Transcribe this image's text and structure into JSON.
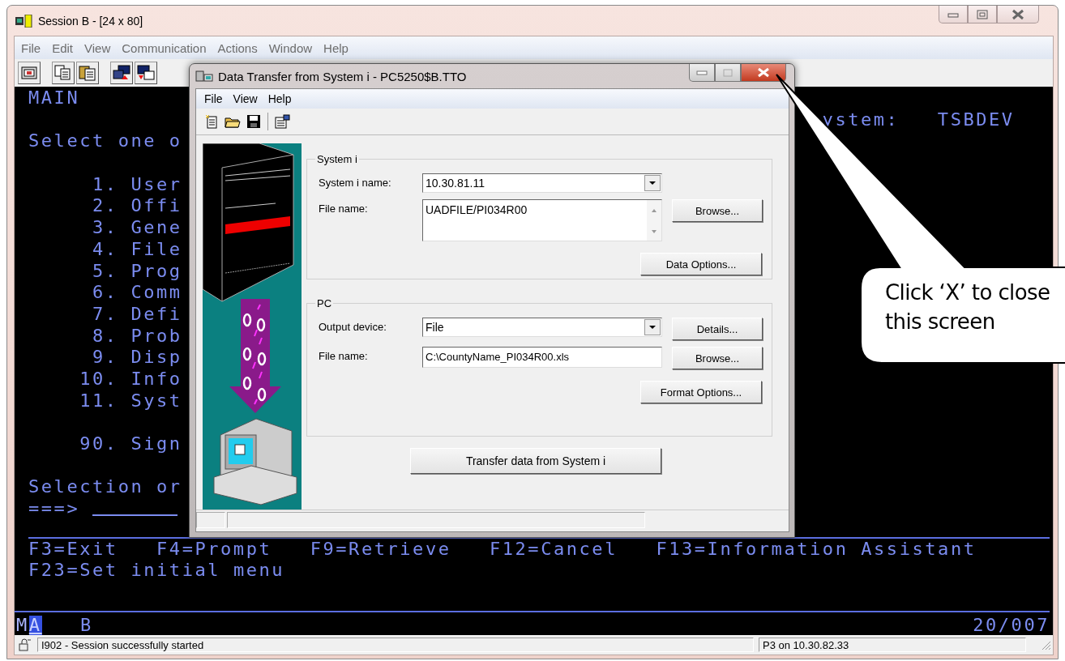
{
  "window": {
    "title": "Session B - [24 x 80]",
    "active": false
  },
  "menu": [
    "File",
    "Edit",
    "View",
    "Communication",
    "Actions",
    "Window",
    "Help"
  ],
  "terminal": {
    "menu_name": "MAIN",
    "system_label": "ystem:",
    "system_value": "TSBDEV",
    "instruction": "Select one o",
    "options": [
      {
        "number": "1.",
        "label": "User"
      },
      {
        "number": "2.",
        "label": "Offi"
      },
      {
        "number": "3.",
        "label": "Gene"
      },
      {
        "number": "4.",
        "label": "File"
      },
      {
        "number": "5.",
        "label": "Prog"
      },
      {
        "number": "6.",
        "label": "Comm"
      },
      {
        "number": "7.",
        "label": "Defi"
      },
      {
        "number": "8.",
        "label": "Prob"
      },
      {
        "number": "9.",
        "label": "Disp"
      },
      {
        "number": "10.",
        "label": "Info"
      },
      {
        "number": "11.",
        "label": "Syst"
      }
    ],
    "signoff": {
      "number": "90.",
      "label": "Sign"
    },
    "selection_label": "Selection or",
    "command_prompt": "===>",
    "function_keys": [
      "F3=Exit",
      "F4=Prompt",
      "F9=Retrieve",
      "F12=Cancel",
      "F13=Information Assistant"
    ],
    "function_keys_2": [
      "F23=Set initial menu"
    ],
    "oia": {
      "mode": "M",
      "cursor_char": "A",
      "session": "B",
      "position": "20/007"
    }
  },
  "status_bar": {
    "message": "I902 - Session successfully started",
    "connection": "P3 on 10.30.82.33"
  },
  "dialog": {
    "title": "Data Transfer from System i - PC5250$B.TTO",
    "active": true,
    "menu": [
      "File",
      "View",
      "Help"
    ],
    "system_group": {
      "legend": "System i",
      "name_label": "System i name:",
      "name_value": "10.30.81.11",
      "file_label": "File name:",
      "file_value": "UADFILE/PI034R00",
      "browse": "Browse...",
      "options_button": "Data Options..."
    },
    "pc_group": {
      "legend": "PC",
      "device_label": "Output device:",
      "device_value": "File",
      "details": "Details...",
      "file_label": "File name:",
      "file_value": "C:\\CountyName_PI034R00.xls",
      "browse": "Browse...",
      "options_button": "Format Options..."
    },
    "transfer_button": "Transfer data from System i"
  },
  "callout": {
    "text": "Click ‘X’ to close this screen"
  }
}
